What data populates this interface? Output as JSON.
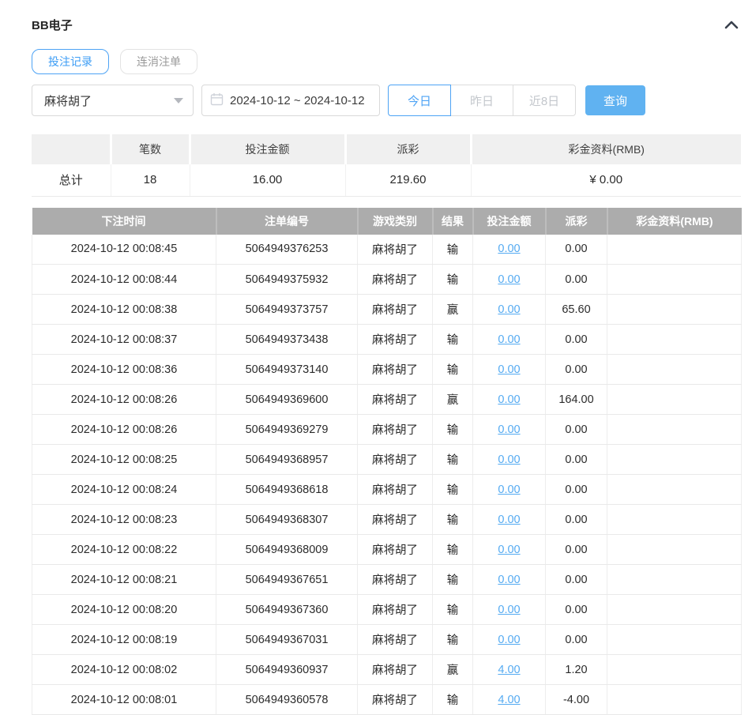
{
  "panel": {
    "title": "BB电子",
    "collapse_icon": "chevron-up"
  },
  "tabs": {
    "bet_records": "投注记录",
    "cancel_orders": "连消注单"
  },
  "filters": {
    "game_selected": "麻将胡了",
    "date_range": "2024-10-12 ~ 2024-10-12",
    "today": "今日",
    "yesterday": "昨日",
    "last8days": "近8日",
    "query": "查询"
  },
  "summary": {
    "headers": {
      "blank": "",
      "count": "笔数",
      "bet_amount": "投注金额",
      "payout": "派彩",
      "bonus": "彩金资料(RMB)"
    },
    "total_label": "总计",
    "total": {
      "count": "18",
      "bet_amount": "16.00",
      "payout": "219.60",
      "bonus": "¥ 0.00"
    }
  },
  "table": {
    "headers": [
      "下注时间",
      "注单编号",
      "游戏类别",
      "结果",
      "投注金额",
      "派彩",
      "彩金资料(RMB)"
    ],
    "rows": [
      {
        "time": "2024-10-12 00:08:45",
        "order": "5064949376253",
        "game": "麻将胡了",
        "result": "输",
        "bet": "0.00",
        "payout": "0.00",
        "bonus": ""
      },
      {
        "time": "2024-10-12 00:08:44",
        "order": "5064949375932",
        "game": "麻将胡了",
        "result": "输",
        "bet": "0.00",
        "payout": "0.00",
        "bonus": ""
      },
      {
        "time": "2024-10-12 00:08:38",
        "order": "5064949373757",
        "game": "麻将胡了",
        "result": "赢",
        "bet": "0.00",
        "payout": "65.60",
        "bonus": ""
      },
      {
        "time": "2024-10-12 00:08:37",
        "order": "5064949373438",
        "game": "麻将胡了",
        "result": "输",
        "bet": "0.00",
        "payout": "0.00",
        "bonus": ""
      },
      {
        "time": "2024-10-12 00:08:36",
        "order": "5064949373140",
        "game": "麻将胡了",
        "result": "输",
        "bet": "0.00",
        "payout": "0.00",
        "bonus": ""
      },
      {
        "time": "2024-10-12 00:08:26",
        "order": "5064949369600",
        "game": "麻将胡了",
        "result": "赢",
        "bet": "0.00",
        "payout": "164.00",
        "bonus": ""
      },
      {
        "time": "2024-10-12 00:08:26",
        "order": "5064949369279",
        "game": "麻将胡了",
        "result": "输",
        "bet": "0.00",
        "payout": "0.00",
        "bonus": ""
      },
      {
        "time": "2024-10-12 00:08:25",
        "order": "5064949368957",
        "game": "麻将胡了",
        "result": "输",
        "bet": "0.00",
        "payout": "0.00",
        "bonus": ""
      },
      {
        "time": "2024-10-12 00:08:24",
        "order": "5064949368618",
        "game": "麻将胡了",
        "result": "输",
        "bet": "0.00",
        "payout": "0.00",
        "bonus": ""
      },
      {
        "time": "2024-10-12 00:08:23",
        "order": "5064949368307",
        "game": "麻将胡了",
        "result": "输",
        "bet": "0.00",
        "payout": "0.00",
        "bonus": ""
      },
      {
        "time": "2024-10-12 00:08:22",
        "order": "5064949368009",
        "game": "麻将胡了",
        "result": "输",
        "bet": "0.00",
        "payout": "0.00",
        "bonus": ""
      },
      {
        "time": "2024-10-12 00:08:21",
        "order": "5064949367651",
        "game": "麻将胡了",
        "result": "输",
        "bet": "0.00",
        "payout": "0.00",
        "bonus": ""
      },
      {
        "time": "2024-10-12 00:08:20",
        "order": "5064949367360",
        "game": "麻将胡了",
        "result": "输",
        "bet": "0.00",
        "payout": "0.00",
        "bonus": ""
      },
      {
        "time": "2024-10-12 00:08:19",
        "order": "5064949367031",
        "game": "麻将胡了",
        "result": "输",
        "bet": "0.00",
        "payout": "0.00",
        "bonus": ""
      },
      {
        "time": "2024-10-12 00:08:02",
        "order": "5064949360937",
        "game": "麻将胡了",
        "result": "赢",
        "bet": "4.00",
        "payout": "1.20",
        "bonus": ""
      },
      {
        "time": "2024-10-12 00:08:01",
        "order": "5064949360578",
        "game": "麻将胡了",
        "result": "输",
        "bet": "4.00",
        "payout": "-4.00",
        "bonus": ""
      }
    ]
  },
  "colors": {
    "accent_blue": "#4da3f5",
    "query_button_blue": "#60b2f1",
    "link_blue": "#55abf2",
    "negative_red": "#f14b50",
    "table_header_gray": "#acacac",
    "summary_header_bg": "#f0f0f0"
  }
}
